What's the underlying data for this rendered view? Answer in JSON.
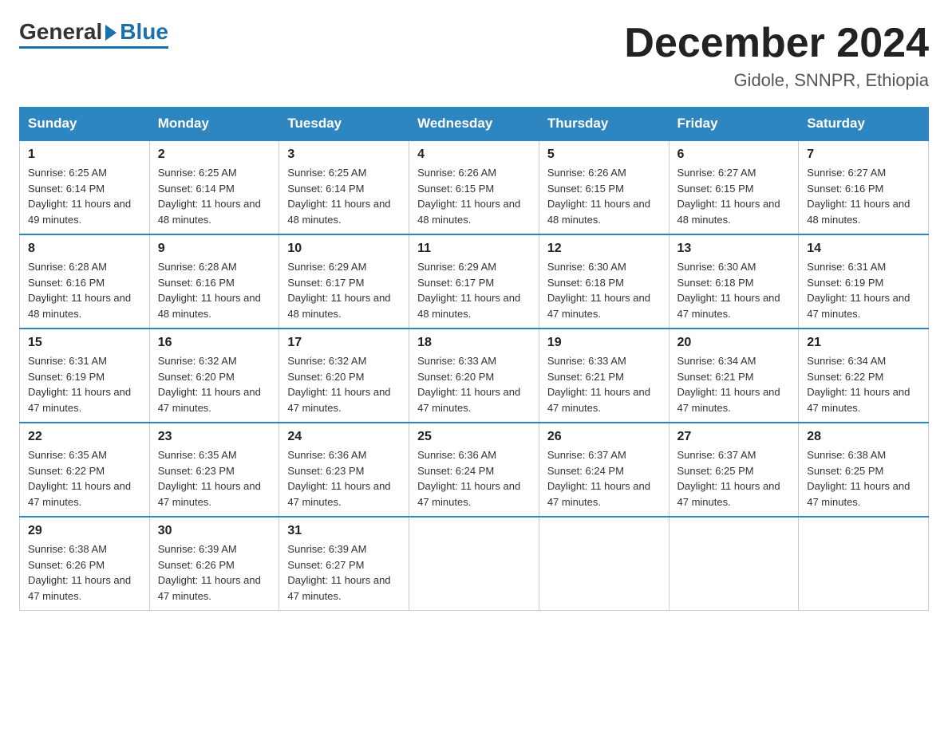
{
  "logo": {
    "general": "General",
    "blue": "Blue"
  },
  "title": "December 2024",
  "location": "Gidole, SNNPR, Ethiopia",
  "days_of_week": [
    "Sunday",
    "Monday",
    "Tuesday",
    "Wednesday",
    "Thursday",
    "Friday",
    "Saturday"
  ],
  "weeks": [
    [
      {
        "day": "1",
        "sunrise": "6:25 AM",
        "sunset": "6:14 PM",
        "daylight": "11 hours and 49 minutes."
      },
      {
        "day": "2",
        "sunrise": "6:25 AM",
        "sunset": "6:14 PM",
        "daylight": "11 hours and 48 minutes."
      },
      {
        "day": "3",
        "sunrise": "6:25 AM",
        "sunset": "6:14 PM",
        "daylight": "11 hours and 48 minutes."
      },
      {
        "day": "4",
        "sunrise": "6:26 AM",
        "sunset": "6:15 PM",
        "daylight": "11 hours and 48 minutes."
      },
      {
        "day": "5",
        "sunrise": "6:26 AM",
        "sunset": "6:15 PM",
        "daylight": "11 hours and 48 minutes."
      },
      {
        "day": "6",
        "sunrise": "6:27 AM",
        "sunset": "6:15 PM",
        "daylight": "11 hours and 48 minutes."
      },
      {
        "day": "7",
        "sunrise": "6:27 AM",
        "sunset": "6:16 PM",
        "daylight": "11 hours and 48 minutes."
      }
    ],
    [
      {
        "day": "8",
        "sunrise": "6:28 AM",
        "sunset": "6:16 PM",
        "daylight": "11 hours and 48 minutes."
      },
      {
        "day": "9",
        "sunrise": "6:28 AM",
        "sunset": "6:16 PM",
        "daylight": "11 hours and 48 minutes."
      },
      {
        "day": "10",
        "sunrise": "6:29 AM",
        "sunset": "6:17 PM",
        "daylight": "11 hours and 48 minutes."
      },
      {
        "day": "11",
        "sunrise": "6:29 AM",
        "sunset": "6:17 PM",
        "daylight": "11 hours and 48 minutes."
      },
      {
        "day": "12",
        "sunrise": "6:30 AM",
        "sunset": "6:18 PM",
        "daylight": "11 hours and 47 minutes."
      },
      {
        "day": "13",
        "sunrise": "6:30 AM",
        "sunset": "6:18 PM",
        "daylight": "11 hours and 47 minutes."
      },
      {
        "day": "14",
        "sunrise": "6:31 AM",
        "sunset": "6:19 PM",
        "daylight": "11 hours and 47 minutes."
      }
    ],
    [
      {
        "day": "15",
        "sunrise": "6:31 AM",
        "sunset": "6:19 PM",
        "daylight": "11 hours and 47 minutes."
      },
      {
        "day": "16",
        "sunrise": "6:32 AM",
        "sunset": "6:20 PM",
        "daylight": "11 hours and 47 minutes."
      },
      {
        "day": "17",
        "sunrise": "6:32 AM",
        "sunset": "6:20 PM",
        "daylight": "11 hours and 47 minutes."
      },
      {
        "day": "18",
        "sunrise": "6:33 AM",
        "sunset": "6:20 PM",
        "daylight": "11 hours and 47 minutes."
      },
      {
        "day": "19",
        "sunrise": "6:33 AM",
        "sunset": "6:21 PM",
        "daylight": "11 hours and 47 minutes."
      },
      {
        "day": "20",
        "sunrise": "6:34 AM",
        "sunset": "6:21 PM",
        "daylight": "11 hours and 47 minutes."
      },
      {
        "day": "21",
        "sunrise": "6:34 AM",
        "sunset": "6:22 PM",
        "daylight": "11 hours and 47 minutes."
      }
    ],
    [
      {
        "day": "22",
        "sunrise": "6:35 AM",
        "sunset": "6:22 PM",
        "daylight": "11 hours and 47 minutes."
      },
      {
        "day": "23",
        "sunrise": "6:35 AM",
        "sunset": "6:23 PM",
        "daylight": "11 hours and 47 minutes."
      },
      {
        "day": "24",
        "sunrise": "6:36 AM",
        "sunset": "6:23 PM",
        "daylight": "11 hours and 47 minutes."
      },
      {
        "day": "25",
        "sunrise": "6:36 AM",
        "sunset": "6:24 PM",
        "daylight": "11 hours and 47 minutes."
      },
      {
        "day": "26",
        "sunrise": "6:37 AM",
        "sunset": "6:24 PM",
        "daylight": "11 hours and 47 minutes."
      },
      {
        "day": "27",
        "sunrise": "6:37 AM",
        "sunset": "6:25 PM",
        "daylight": "11 hours and 47 minutes."
      },
      {
        "day": "28",
        "sunrise": "6:38 AM",
        "sunset": "6:25 PM",
        "daylight": "11 hours and 47 minutes."
      }
    ],
    [
      {
        "day": "29",
        "sunrise": "6:38 AM",
        "sunset": "6:26 PM",
        "daylight": "11 hours and 47 minutes."
      },
      {
        "day": "30",
        "sunrise": "6:39 AM",
        "sunset": "6:26 PM",
        "daylight": "11 hours and 47 minutes."
      },
      {
        "day": "31",
        "sunrise": "6:39 AM",
        "sunset": "6:27 PM",
        "daylight": "11 hours and 47 minutes."
      },
      null,
      null,
      null,
      null
    ]
  ]
}
